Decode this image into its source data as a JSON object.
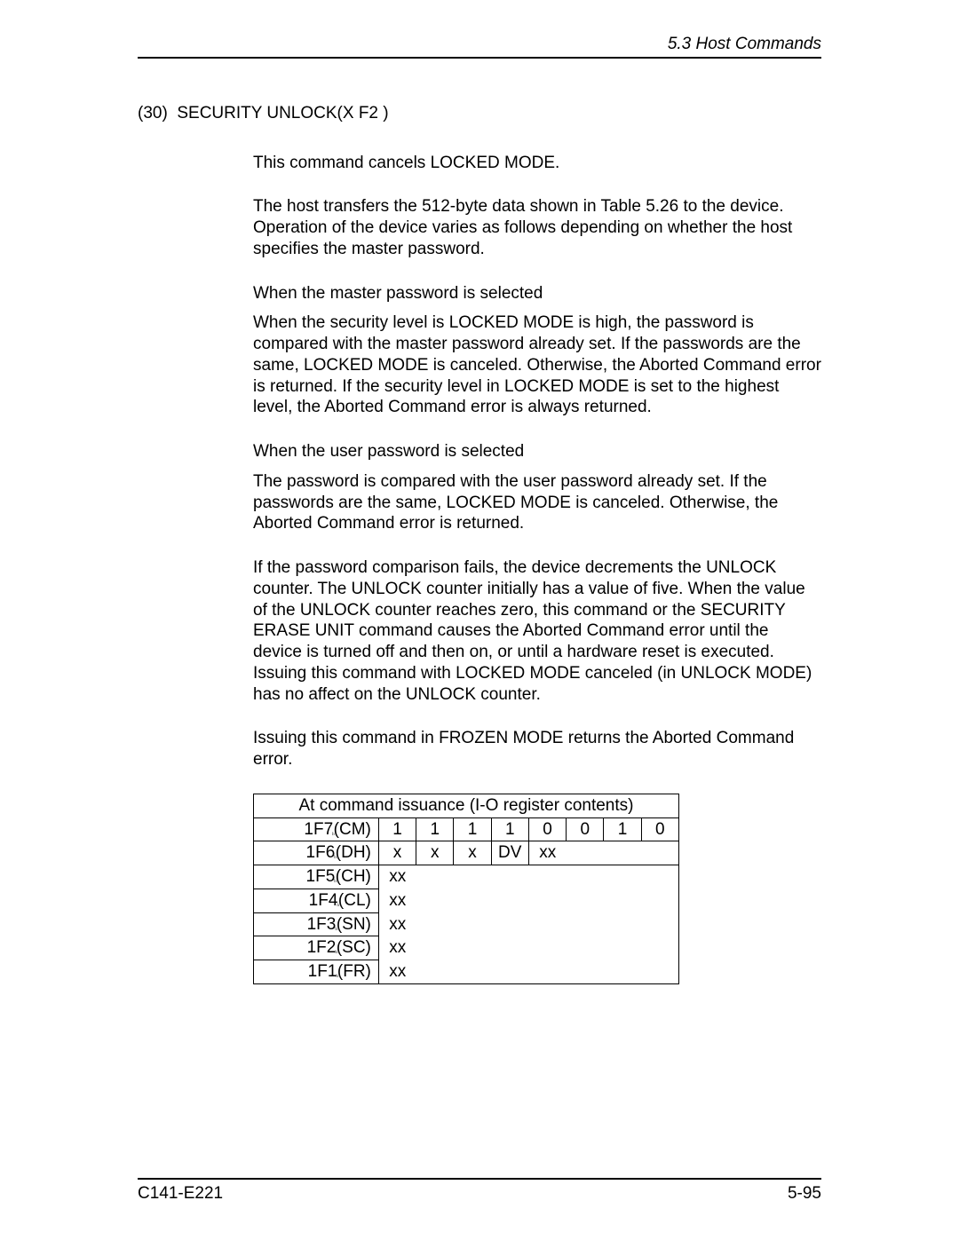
{
  "header": {
    "section": "5.3  Host Commands"
  },
  "footer": {
    "docnum": "C141-E221",
    "pagenum": "5-95"
  },
  "heading": {
    "num": "(30)",
    "title": "SECURITY UNLOCK(X F2 )"
  },
  "body": {
    "p1": "This command cancels LOCKED MODE.",
    "p2": "The host transfers the 512-byte data shown in Table 5.26 to the device.  Operation of the device varies as follows depending on whether the host specifies the master password.",
    "p3": "When the master password is selected",
    "p4": "When the security level is LOCKED MODE is high, the password is compared with the master password already set.  If the passwords are the same, LOCKED MODE is canceled.  Otherwise, the Aborted Command error is returned.  If the security level in LOCKED MODE is set to the highest level, the Aborted Command error is always returned.",
    "p5": "When the user password is selected",
    "p6": "The password is compared with the user password already set.  If the passwords are the same, LOCKED MODE is canceled. Otherwise, the Aborted Command error is returned.",
    "p7": "If the password comparison fails, the device decrements the UNLOCK counter.  The UNLOCK counter initially has a value of five.  When the value of the UNLOCK counter reaches zero, this command or the SECURITY ERASE UNIT command causes the Aborted Command error until the device is turned off and then on, or until a hardware reset is executed.  Issuing this command with LOCKED MODE canceled (in UNLOCK MODE) has no affect on the UNLOCK counter.",
    "p8": "Issuing this command in FROZEN MODE returns the Aborted Command error."
  },
  "table": {
    "title": "At command issuance (I-O register contents)",
    "rows": [
      {
        "label_reg": "1F7",
        "label_suffix": "(CM)",
        "cells": [
          "1",
          "1",
          "1",
          "1",
          "0",
          "0",
          "1",
          "0"
        ]
      },
      {
        "label_reg": "1F6",
        "label_suffix": "(DH)",
        "cells": [
          "x",
          "x",
          "x",
          "DV",
          "xx",
          "",
          "",
          ""
        ]
      },
      {
        "label_reg": "1F5",
        "label_suffix": "(CH)",
        "cells": [
          "xx",
          "",
          "",
          "",
          "",
          "",
          "",
          ""
        ]
      },
      {
        "label_reg": "1F4",
        "label_suffix": "(CL)",
        "cells": [
          "xx",
          "",
          "",
          "",
          "",
          "",
          "",
          ""
        ]
      },
      {
        "label_reg": "1F3",
        "label_suffix": "(SN)",
        "cells": [
          "xx",
          "",
          "",
          "",
          "",
          "",
          "",
          ""
        ]
      },
      {
        "label_reg": "1F2",
        "label_suffix": "(SC)",
        "cells": [
          "xx",
          "",
          "",
          "",
          "",
          "",
          "",
          ""
        ]
      },
      {
        "label_reg": "1F1",
        "label_suffix": "(FR)",
        "cells": [
          "xx",
          "",
          "",
          "",
          "",
          "",
          "",
          ""
        ]
      }
    ]
  }
}
